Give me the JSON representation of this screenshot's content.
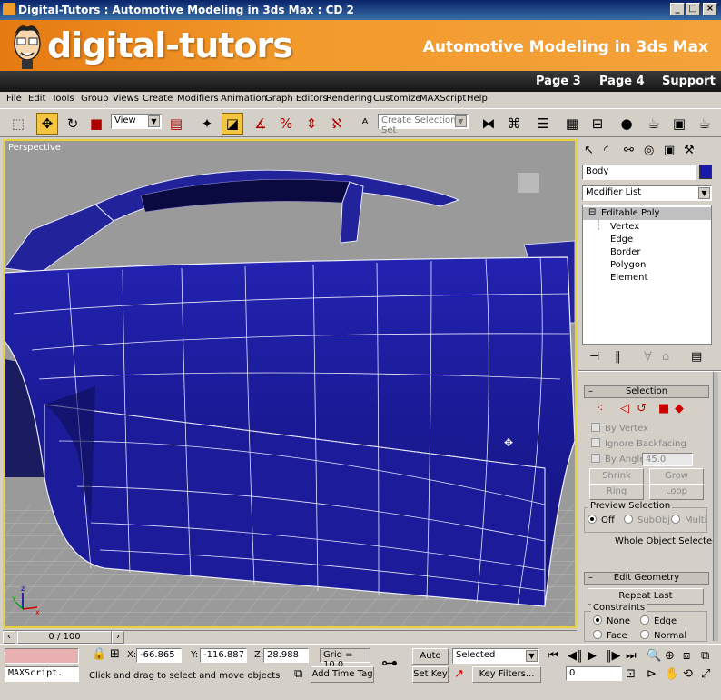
{
  "window": {
    "title": "Digital-Tutors : Automotive Modeling in 3ds Max : CD 2",
    "min": "_",
    "max": "□",
    "close": "×"
  },
  "banner": {
    "logo": "digital-tutors",
    "course_title": "Automotive Modeling in 3ds Max"
  },
  "pagenav": {
    "page3": "Page 3",
    "page4": "Page 4",
    "support": "Support"
  },
  "menu": [
    "File",
    "Edit",
    "Tools",
    "Group",
    "Views",
    "Create",
    "Modifiers",
    "Animation",
    "Graph Editors",
    "Rendering",
    "Customize",
    "MAXScript",
    "Help"
  ],
  "toolbar": {
    "ref_coord": "View",
    "selection_set": "Create Selection Set"
  },
  "viewport": {
    "label": "Perspective"
  },
  "cmdpanel": {
    "object_name": "Body",
    "object_color": "#1a1aa8",
    "modifier_list": "Modifier List",
    "stack": [
      "Editable Poly",
      "Vertex",
      "Edge",
      "Border",
      "Polygon",
      "Element"
    ],
    "selection": {
      "title": "Selection",
      "by_vertex": "By Vertex",
      "ignore_backfacing": "Ignore Backfacing",
      "by_angle": "By Angle:",
      "angle_value": "45.0",
      "shrink": "Shrink",
      "grow": "Grow",
      "ring": "Ring",
      "loop": "Loop",
      "preview_title": "Preview Selection",
      "preview_off": "Off",
      "preview_subobj": "SubObj",
      "preview_multi": "Multi",
      "status": "Whole Object Selected"
    },
    "edit_geometry": {
      "title": "Edit Geometry",
      "repeat_last": "Repeat Last",
      "constraints": "Constraints",
      "none": "None",
      "edge": "Edge",
      "face": "Face",
      "normal": "Normal"
    }
  },
  "timeslider": {
    "frame": "0 / 100"
  },
  "status": {
    "maxscript": "MAXScript.",
    "x_label": "X:",
    "x": "-66.865",
    "y_label": "Y:",
    "y": "-116.887",
    "z_label": "Z:",
    "z": "28.988",
    "grid": "Grid = 10.0",
    "prompt": "Click and drag to select and move objects",
    "add_time_tag": "Add Time Tag",
    "auto_key": "Auto Key",
    "set_key": "Set Key",
    "selected": "Selected",
    "key_filters": "Key Filters...",
    "frame_field": "0"
  }
}
